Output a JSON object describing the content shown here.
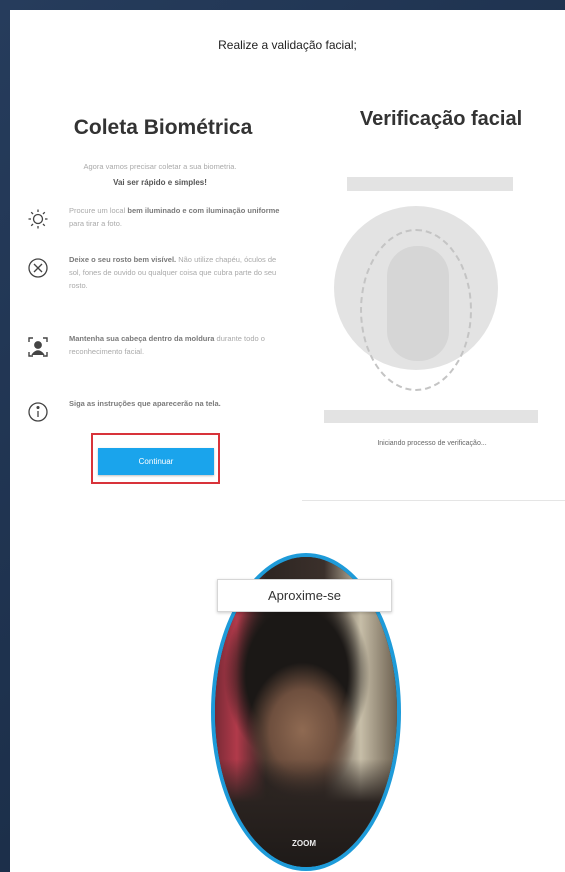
{
  "header": {
    "title": "Realize a validação facial;"
  },
  "biometric": {
    "heading": "Coleta Biométrica",
    "intro_line1": "Agora vamos precisar coletar a sua biometria.",
    "intro_line2": "Vai ser rápido e simples!",
    "instructions": [
      {
        "icon": "sun-icon",
        "bold": "",
        "text_before": "Procure um local ",
        "bold_text": "bem iluminado e com iluminação uniforme",
        "text_after": " para tirar a foto."
      },
      {
        "icon": "close-circle-icon",
        "text_before": "",
        "bold_text": "Deixe o seu rosto bem visível.",
        "text_after": " Não utilize chapéu, óculos de sol, fones de ouvido ou qualquer coisa que cubra parte do seu rosto."
      },
      {
        "icon": "face-frame-icon",
        "text_before": "",
        "bold_text": "Mantenha sua cabeça dentro da moldura",
        "text_after": " durante todo o reconhecimento facial."
      },
      {
        "icon": "info-icon",
        "text_before": "",
        "bold_text": "Siga as instruções que aparecerão na tela.",
        "text_after": ""
      }
    ],
    "continue_label": "Continuar"
  },
  "verification": {
    "heading": "Verificação facial",
    "status": "Iniciando processo de verificação..."
  },
  "camera": {
    "prompt": "Aproxime-se",
    "logo": "ZOOM"
  },
  "colors": {
    "accent": "#1aa4ec",
    "highlight_border": "#d8333a",
    "camera_ring": "#1e9bd9"
  }
}
